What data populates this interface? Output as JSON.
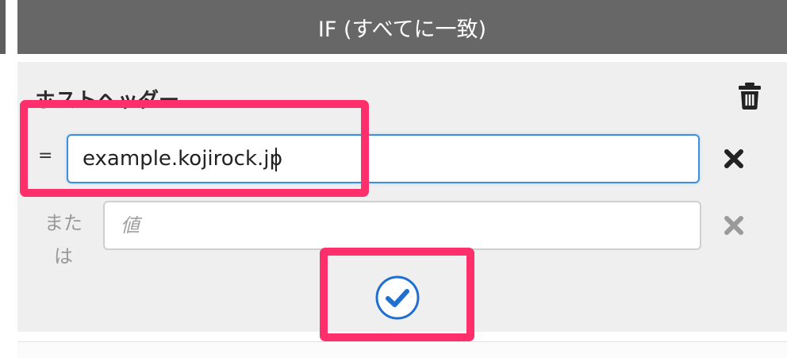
{
  "header": {
    "title": "IF (すべてに一致)"
  },
  "rule": {
    "title": "ホストヘッダー",
    "operator": "=",
    "value": "example.kojirock.jp",
    "or_label": "または",
    "alt_placeholder": "値"
  },
  "icons": {
    "delete_rule": "trash-icon",
    "remove_value": "x-icon",
    "confirm": "check-circle-icon"
  },
  "colors": {
    "header_bg": "#676767",
    "panel_bg": "#efefef",
    "input_focus": "#3d8fe0",
    "confirm_blue": "#1f6fd1",
    "highlight": "#ff2f6c"
  }
}
